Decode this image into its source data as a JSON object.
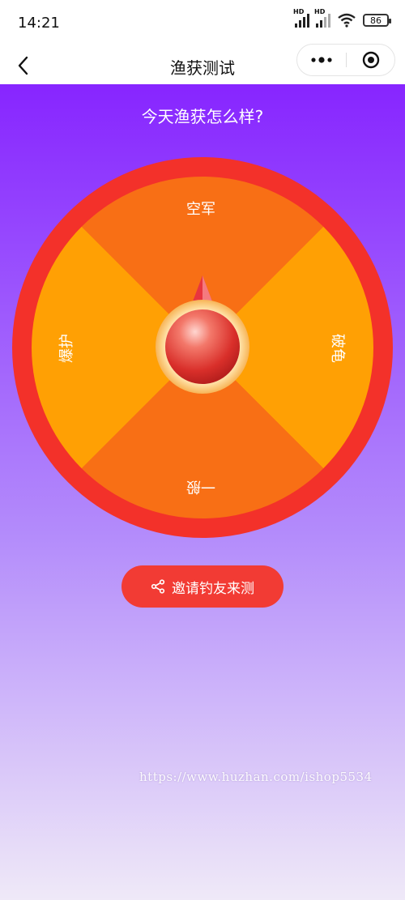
{
  "status_bar": {
    "time": "14:21",
    "signal1_label": "HD",
    "signal2_label": "HD",
    "battery": "86"
  },
  "nav": {
    "title": "渔获测试",
    "back_icon": "chevron-left-icon",
    "more_icon": "more-dots-icon",
    "target_icon": "target-icon"
  },
  "main": {
    "question": "今天渔获怎么样?",
    "wheel": {
      "segments": [
        "空军",
        "破龟",
        "一般",
        "爆护"
      ],
      "colors": {
        "rim": "#f3312a",
        "segment_dark": "#f86f15",
        "segment_light": "#ffa004",
        "pointer": "#e8353f"
      }
    },
    "invite_button": "邀请钓友来测",
    "invite_icon": "share-icon"
  },
  "watermark": "https://www.huzhan.com/ishop5534"
}
